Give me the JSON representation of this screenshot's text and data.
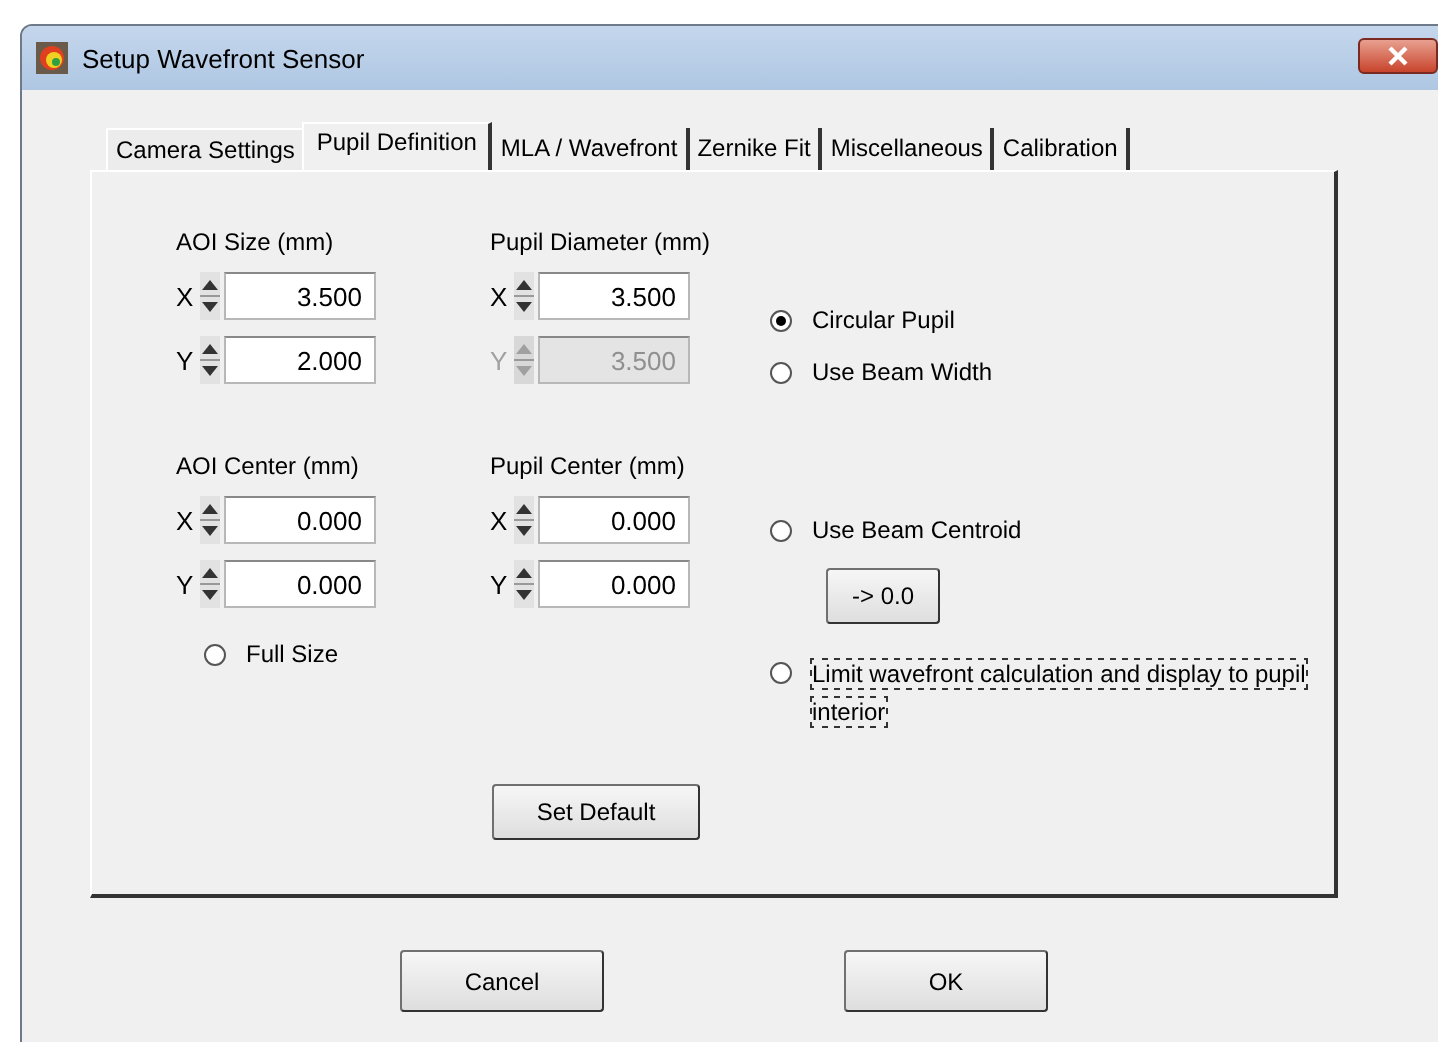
{
  "window": {
    "title": "Setup Wavefront Sensor"
  },
  "tabs": [
    {
      "label": "Camera Settings",
      "selected": false
    },
    {
      "label": "Pupil Definition",
      "selected": true
    },
    {
      "label": "MLA / Wavefront",
      "selected": false
    },
    {
      "label": "Zernike Fit",
      "selected": false
    },
    {
      "label": "Miscellaneous",
      "selected": false
    },
    {
      "label": "Calibration",
      "selected": false
    }
  ],
  "groups": [
    {
      "title": "AOI Size (mm)",
      "fields": [
        {
          "axis": "X",
          "value": "3.500",
          "disabled": false
        },
        {
          "axis": "Y",
          "value": "2.000",
          "disabled": false
        }
      ]
    },
    {
      "title": "Pupil Diameter (mm)",
      "fields": [
        {
          "axis": "X",
          "value": "3.500",
          "disabled": false
        },
        {
          "axis": "Y",
          "value": "3.500",
          "disabled": true
        }
      ]
    },
    {
      "title": "AOI Center (mm)",
      "fields": [
        {
          "axis": "X",
          "value": "0.000",
          "disabled": false
        },
        {
          "axis": "Y",
          "value": "0.000",
          "disabled": false
        }
      ]
    },
    {
      "title": "Pupil Center (mm)",
      "fields": [
        {
          "axis": "X",
          "value": "0.000",
          "disabled": false
        },
        {
          "axis": "Y",
          "value": "0.000",
          "disabled": false
        }
      ]
    }
  ],
  "full_size_option": {
    "label": "Full Size",
    "selected": false
  },
  "pupil_options": [
    {
      "label": "Circular Pupil",
      "selected": true
    },
    {
      "label": "Use Beam Width",
      "selected": false
    }
  ],
  "centroid_option": {
    "label": "Use Beam Centroid",
    "selected": false
  },
  "zero_button": "-> 0.0",
  "limit_option": {
    "label": "Limit wavefront calculation and display to pupil interior",
    "selected": false
  },
  "set_default_button": "Set Default",
  "buttons": [
    "Cancel",
    "OK"
  ]
}
